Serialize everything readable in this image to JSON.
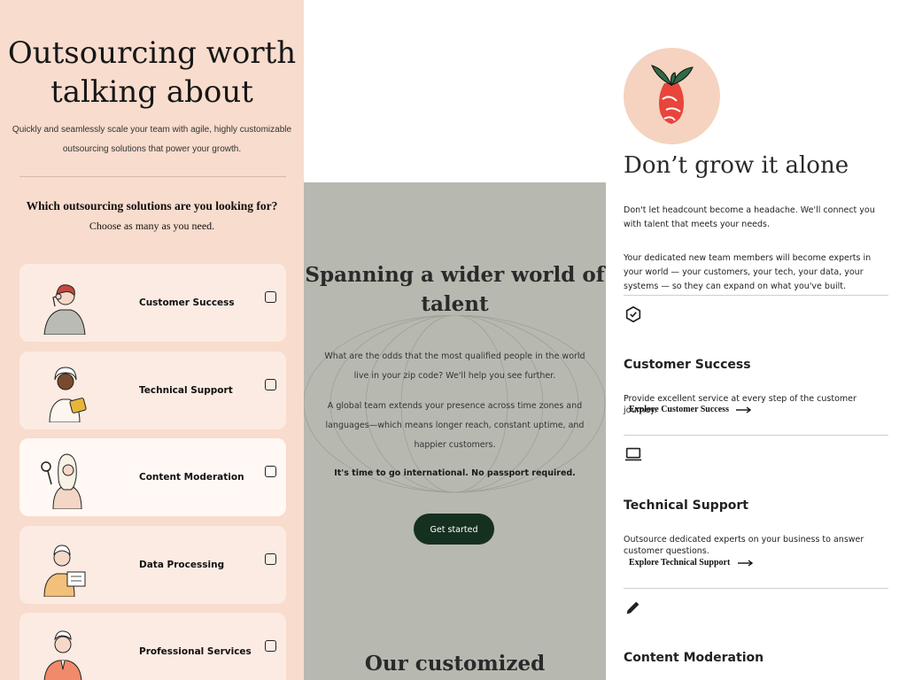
{
  "left": {
    "title": "Outsourcing worth talking about",
    "subtitle": "Quickly and seamlessly scale your team with agile, highly customizable outsourcing solutions that power your growth.",
    "question": "Which outsourcing solutions are you looking for?",
    "question_hint": "Choose as many as you need.",
    "options": [
      {
        "label": "Customer Success",
        "checked": false
      },
      {
        "label": "Technical Support",
        "checked": false
      },
      {
        "label": "Content Moderation",
        "checked": false
      },
      {
        "label": "Data Processing",
        "checked": false
      },
      {
        "label": "Professional Services",
        "checked": false
      }
    ]
  },
  "middle": {
    "title": "Spanning a wider world of talent",
    "para1": "What are the odds that the most qualified people in the world live in your zip code? We'll help you see further.",
    "para2": "A global team extends your presence across time zones and languages—which means longer reach, constant uptime, and happier customers.",
    "para3": "It's time to go international. No passport required.",
    "cta": "Get started",
    "next_heading": "Our customized"
  },
  "right": {
    "title": "Don’t grow it alone",
    "para1": "Don't let headcount become a headache. We'll connect you with talent that meets your needs.",
    "para2": "Your dedicated new team members will become experts in your world — your customers, your tech, your data, your systems — so they can expand on what you've built.",
    "services": [
      {
        "icon": "shield-check-icon",
        "title": "Customer Success",
        "desc": "Provide excellent service at every step of the customer journey.",
        "link": "Explore Customer Success"
      },
      {
        "icon": "laptop-icon",
        "title": "Technical Support",
        "desc": "Outsource dedicated experts on your business to answer customer questions.",
        "link": "Explore Technical Support"
      },
      {
        "icon": "pencil-icon",
        "title": "Content Moderation",
        "desc": "",
        "link": ""
      }
    ]
  },
  "colors": {
    "left_bg": "#f8dccd",
    "card_bg": "#fbebe3",
    "middle_bg": "#b7b9b0",
    "cta_bg": "#16301f",
    "pot_circle": "#f5d3c0",
    "pot_red": "#e8453c"
  }
}
